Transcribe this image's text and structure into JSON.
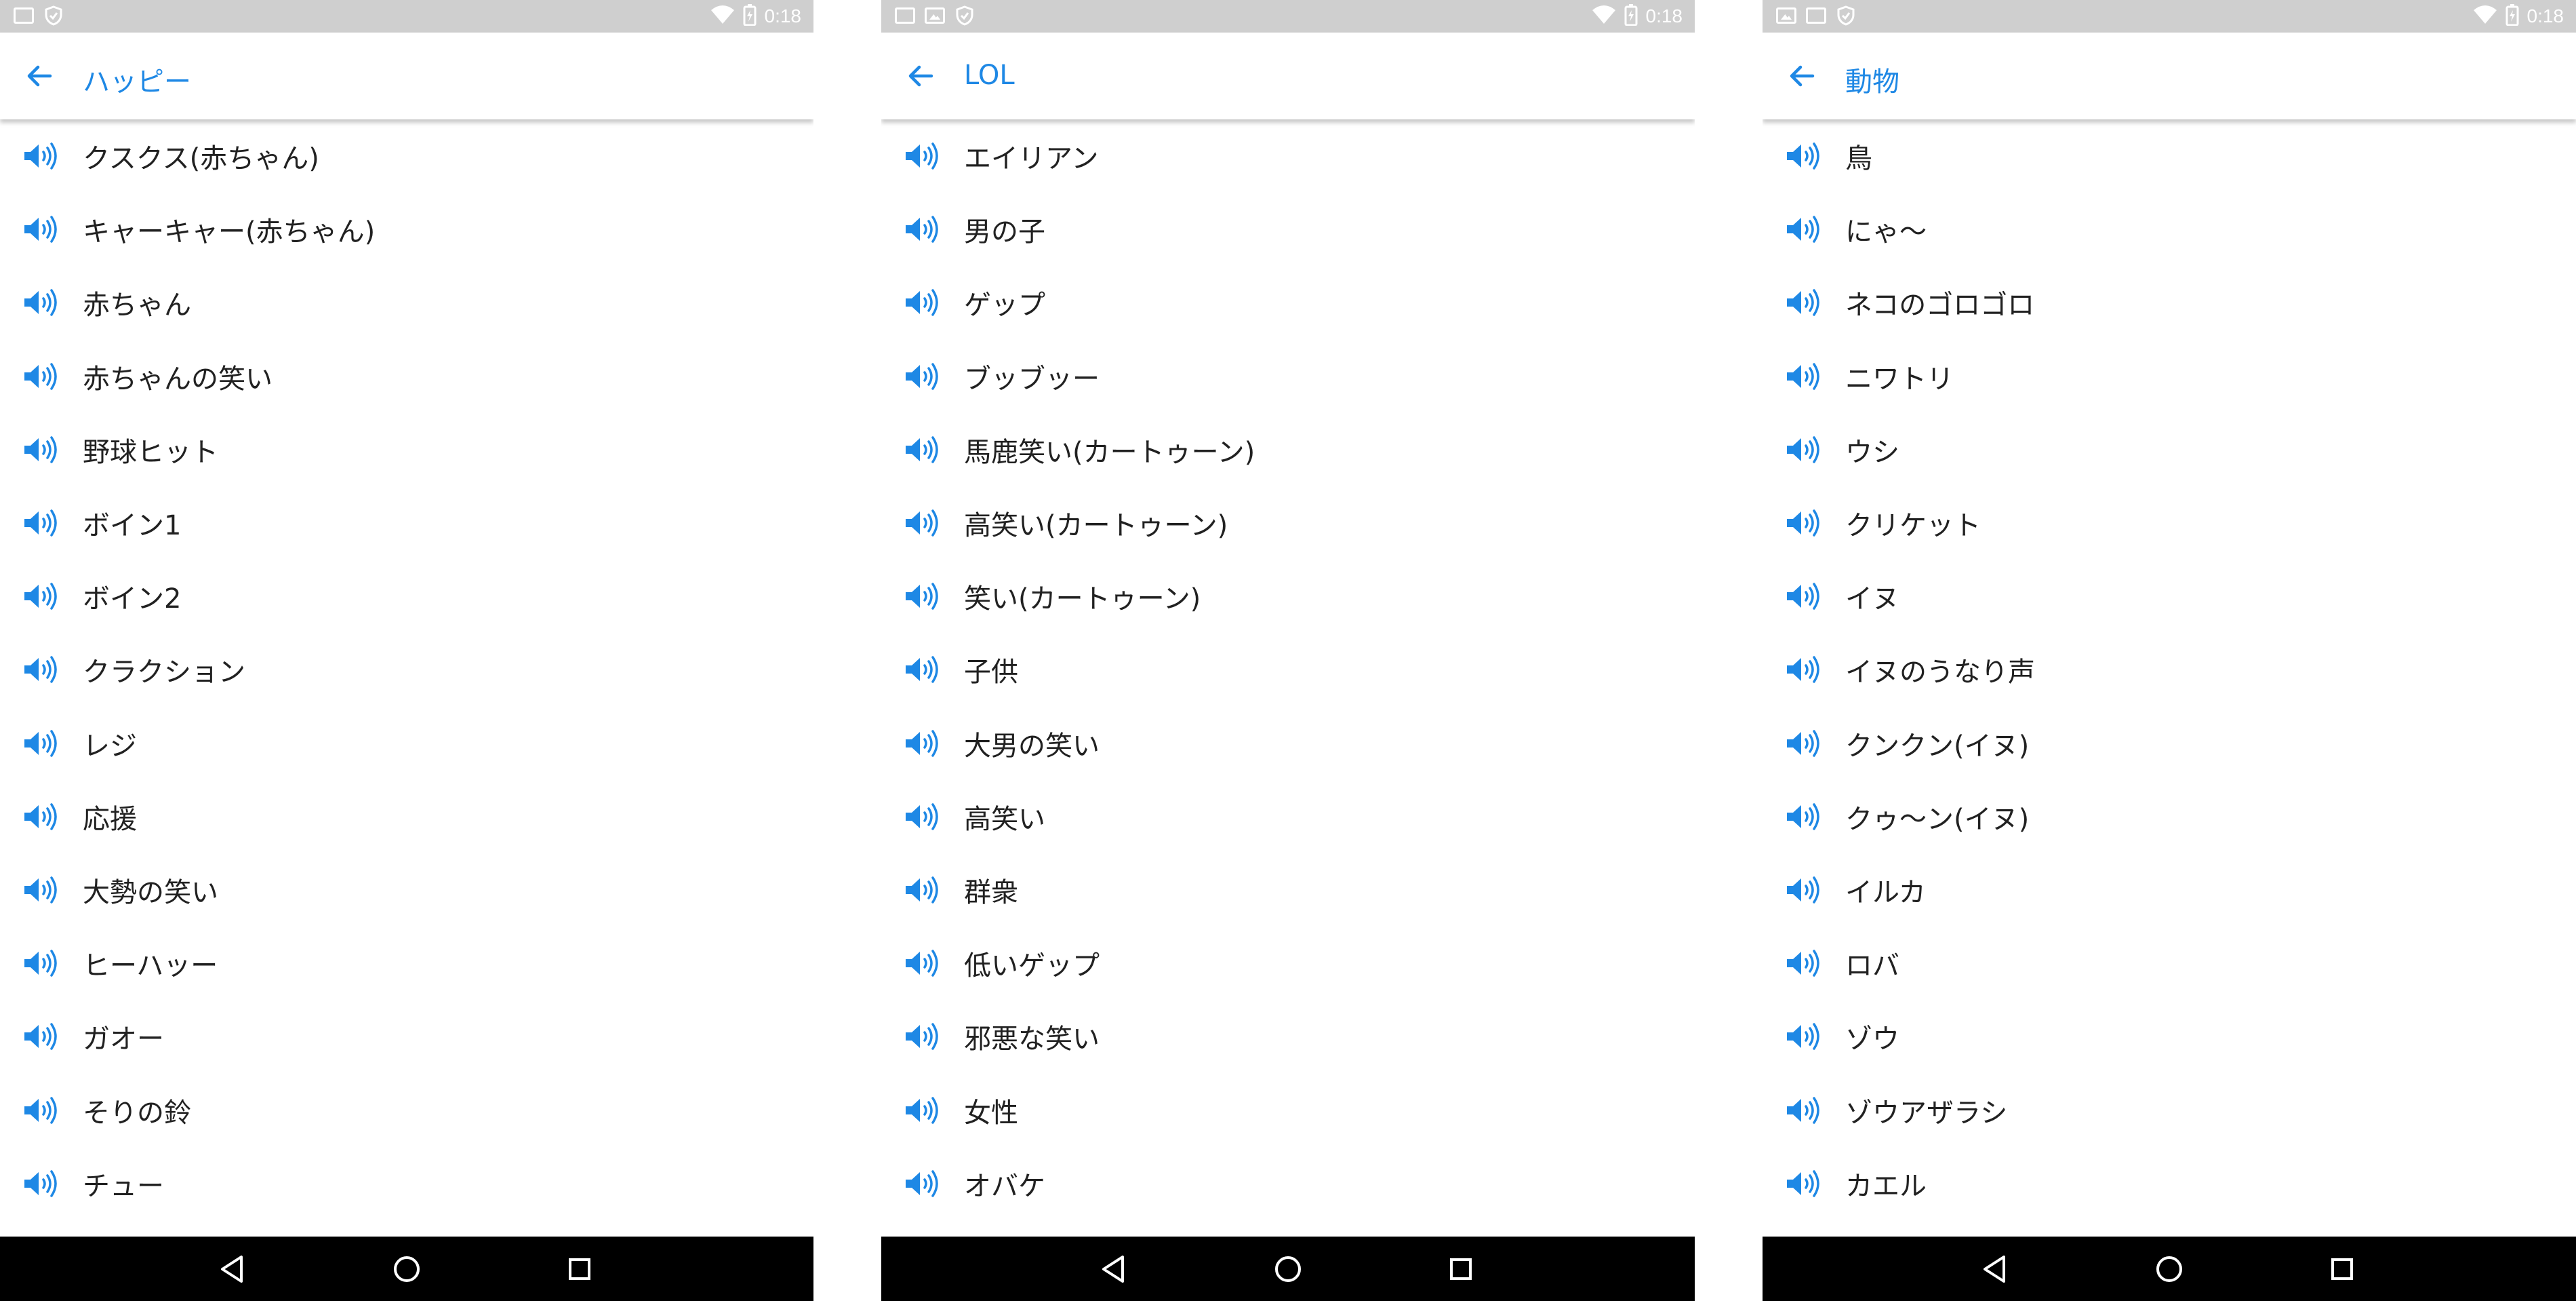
{
  "colors": {
    "accent": "#1e88e5",
    "text": "#212121",
    "status_bar": "#cfcfcf",
    "nav_bar": "#000000"
  },
  "screens": [
    {
      "status": {
        "time": "0:18",
        "left_icons": [
          "keyboard-icon",
          "shield-icon"
        ]
      },
      "title": "ハッピー",
      "items": [
        "クスクス(赤ちゃん)",
        "キャーキャー(赤ちゃん)",
        "赤ちゃん",
        "赤ちゃんの笑い",
        "野球ヒット",
        "ボイン1",
        "ボイン2",
        "クラクション",
        "レジ",
        "応援",
        "大勢の笑い",
        "ヒーハッー",
        "ガオー",
        "そりの鈴",
        "チュー"
      ]
    },
    {
      "status": {
        "time": "0:18",
        "left_icons": [
          "keyboard-icon",
          "image-icon",
          "shield-icon"
        ]
      },
      "title": "LOL",
      "items": [
        "エイリアン",
        "男の子",
        "ゲップ",
        "ブッブッー",
        "馬鹿笑い(カートゥーン)",
        "高笑い(カートゥーン)",
        "笑い(カートゥーン)",
        "子供",
        "大男の笑い",
        "高笑い",
        "群衆",
        "低いゲップ",
        "邪悪な笑い",
        "女性",
        "オバケ"
      ]
    },
    {
      "status": {
        "time": "0:18",
        "left_icons": [
          "image-icon",
          "keyboard-icon",
          "shield-icon"
        ]
      },
      "title": "動物",
      "items": [
        "鳥",
        "にゃ〜",
        "ネコのゴロゴロ",
        "ニワトリ",
        "ウシ",
        "クリケット",
        "イヌ",
        "イヌのうなり声",
        "クンクン(イヌ)",
        "クゥ〜ン(イヌ)",
        "イルカ",
        "ロバ",
        "ゾウ",
        "ゾウアザラシ",
        "カエル"
      ]
    }
  ]
}
